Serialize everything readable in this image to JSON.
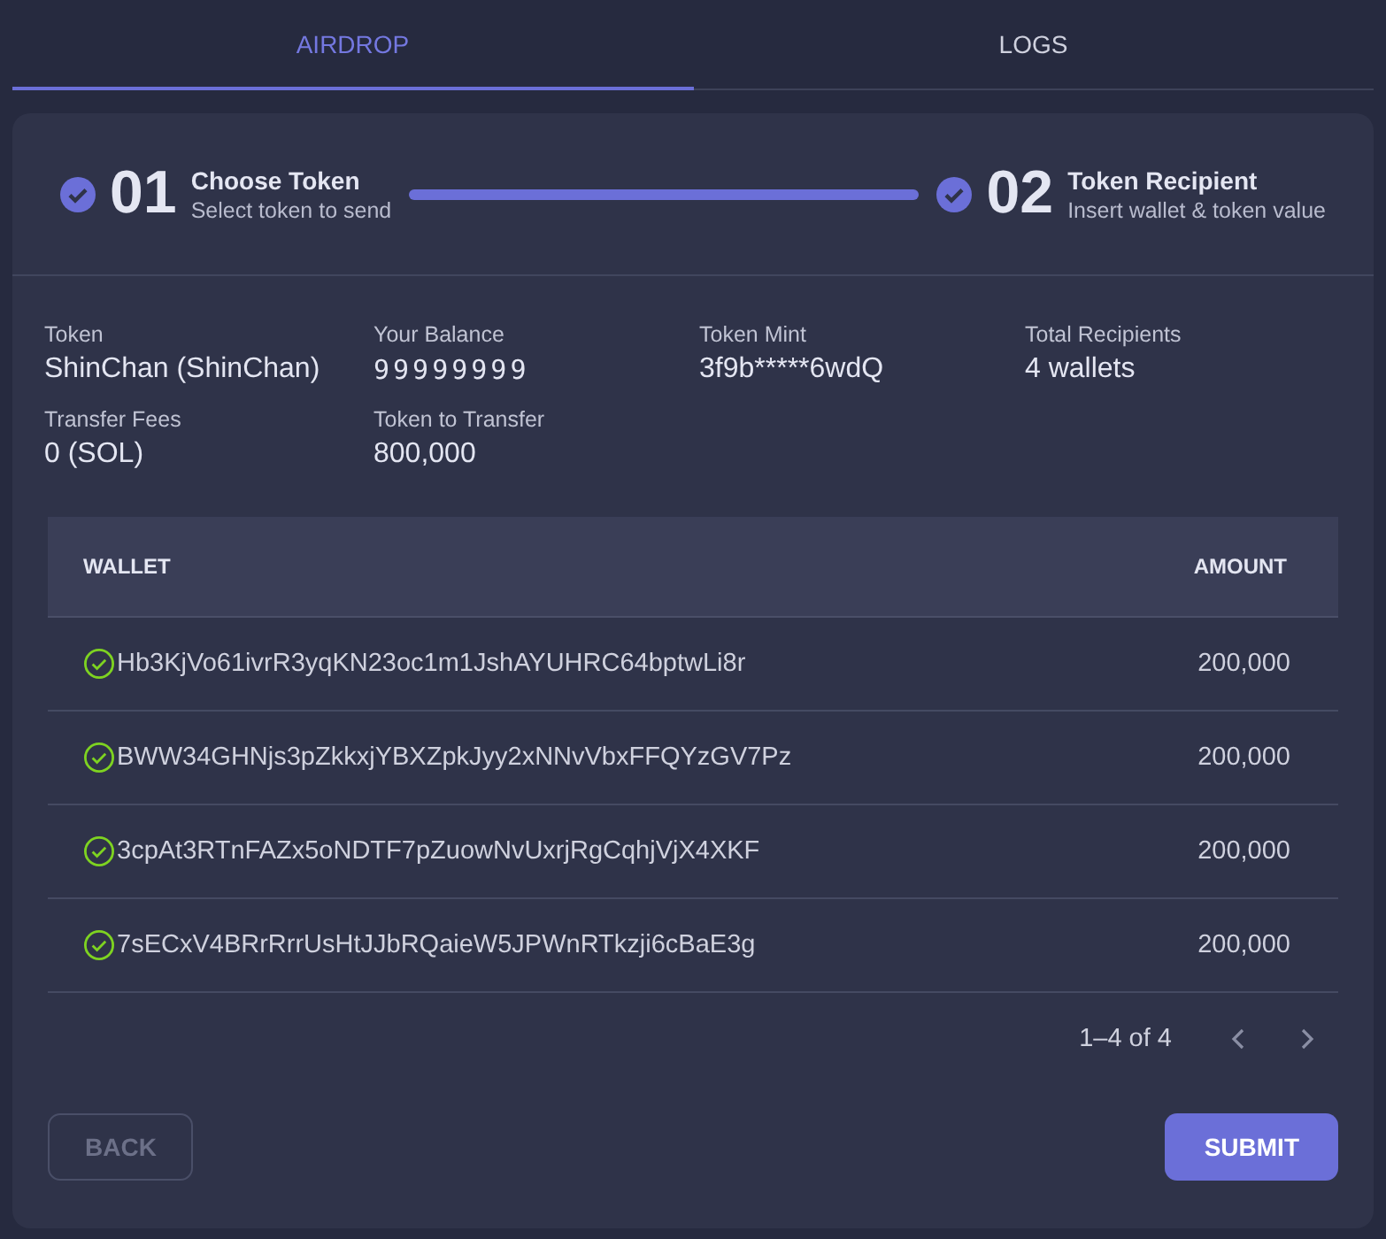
{
  "tabs": [
    {
      "label": "AIRDROP",
      "selected": true
    },
    {
      "label": "LOGS",
      "selected": false
    }
  ],
  "steps": [
    {
      "number": "01",
      "title": "Choose Token",
      "subtitle": "Select token to send",
      "completed": true
    },
    {
      "number": "02",
      "title": "Token Recipient",
      "subtitle": "Insert wallet & token value",
      "completed": true
    }
  ],
  "summary": [
    {
      "label": "Token",
      "value": "ShinChan (ShinChan)",
      "kind": "text"
    },
    {
      "label": "Your Balance",
      "value": "99999999",
      "kind": "mono"
    },
    {
      "label": "Token Mint",
      "value": "3f9b*****6wdQ",
      "kind": "text"
    },
    {
      "label": "Total Recipients",
      "value": "4 wallets",
      "kind": "text"
    },
    {
      "label": "Transfer Fees",
      "value": "0 (SOL)",
      "kind": "text"
    },
    {
      "label": "Token to Transfer",
      "value": "800,000",
      "kind": "text"
    }
  ],
  "table": {
    "columns": [
      "WALLET",
      "AMOUNT"
    ],
    "rows": [
      {
        "wallet": "Hb3KjVo61ivrR3yqKN23oc1m1JshAYUHRC64bptwLi8r",
        "amount": "200,000",
        "valid": true
      },
      {
        "wallet": "BWW34GHNjs3pZkkxjYBXZpkJyy2xNNvVbxFFQYzGV7Pz",
        "amount": "200,000",
        "valid": true
      },
      {
        "wallet": "3cpAt3RTnFAZx5oNDTF7pZuowNvUxrjRgCqhjVjX4XKF",
        "amount": "200,000",
        "valid": true
      },
      {
        "wallet": "7sECxV4BRrRrrUsHtJJbRQaieW5JPWnRTkzji6cBaE3g",
        "amount": "200,000",
        "valid": true
      }
    ]
  },
  "pagination": {
    "range": "1–4 of 4",
    "prev_disabled": true,
    "next_disabled": true
  },
  "buttons": [
    {
      "label": "BACK",
      "disabled": true
    },
    {
      "label": "SUBMIT",
      "disabled": false
    }
  ]
}
